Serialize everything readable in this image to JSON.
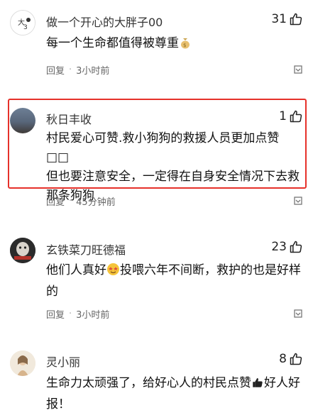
{
  "comments": [
    {
      "username": "做一个开心的大胖子00",
      "likes": "31",
      "text": "每一个生命都值得被尊重",
      "emoji": "💰",
      "reply": "回复",
      "time": "3小时前"
    },
    {
      "username": "秋日丰收",
      "likes": "1",
      "text_line1": "村民爱心可赞.救小狗狗的救援人员更加点赞",
      "text_line1_suffix": "□□",
      "text_line2": "但也要注意安全，一定得在自身安全情况下去救",
      "text_line3": "那条狗狗",
      "reply": "回复",
      "time": "45分钟前",
      "highlighted": true
    },
    {
      "username": "玄铁菜刀旺德福",
      "likes": "23",
      "text_part1": "他们人真好",
      "text_part2": "投喂六年不间断，救护的也是好样",
      "text_line2": "的",
      "emoji": "🤩",
      "reply": "回复",
      "time": "3小时前"
    },
    {
      "username": "灵小丽",
      "likes": "8",
      "text_part1": "生命力太顽强了，给好心人的村民点赞",
      "text_part2": "好人好",
      "text_line2": "报！",
      "emoji": "👍"
    }
  ],
  "colors": {
    "highlight_border": "#e6312a",
    "meta_text": "#666666"
  },
  "icons": [
    "thumbs-up-icon",
    "more-icon"
  ]
}
